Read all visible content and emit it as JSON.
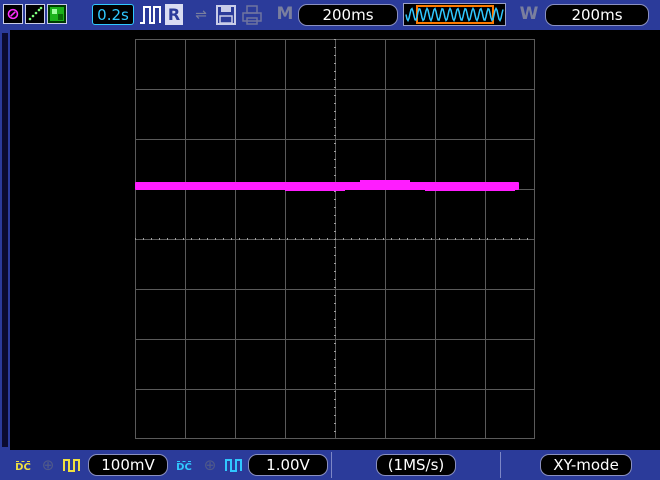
{
  "status": {
    "timebase": "0.2s",
    "run_state": "R",
    "marker": "M",
    "horizontal_time": "200ms",
    "window_marker": "W",
    "window_time": "200ms"
  },
  "icons": {
    "run_stop": "play-pause-icon",
    "display_mode": "xy-dots-icon",
    "persist": "persist-icon",
    "trigger": "pulse-trigger-icon",
    "usb": "usb-icon",
    "save": "floppy-disk-icon",
    "print": "printer-icon",
    "waveform_preview": "waveform-icon"
  },
  "colors": {
    "bar": "#2b3b9a",
    "trace": "#ff1dff",
    "ch1": "#f0e040",
    "ch2": "#30c8ff"
  },
  "channels": [
    {
      "coupling": "DC",
      "scale": "100mV"
    },
    {
      "coupling": "DC",
      "scale": "1.00V"
    }
  ],
  "acquisition": {
    "sample_rate": "(1MS/s)",
    "mode": "XY-mode"
  }
}
